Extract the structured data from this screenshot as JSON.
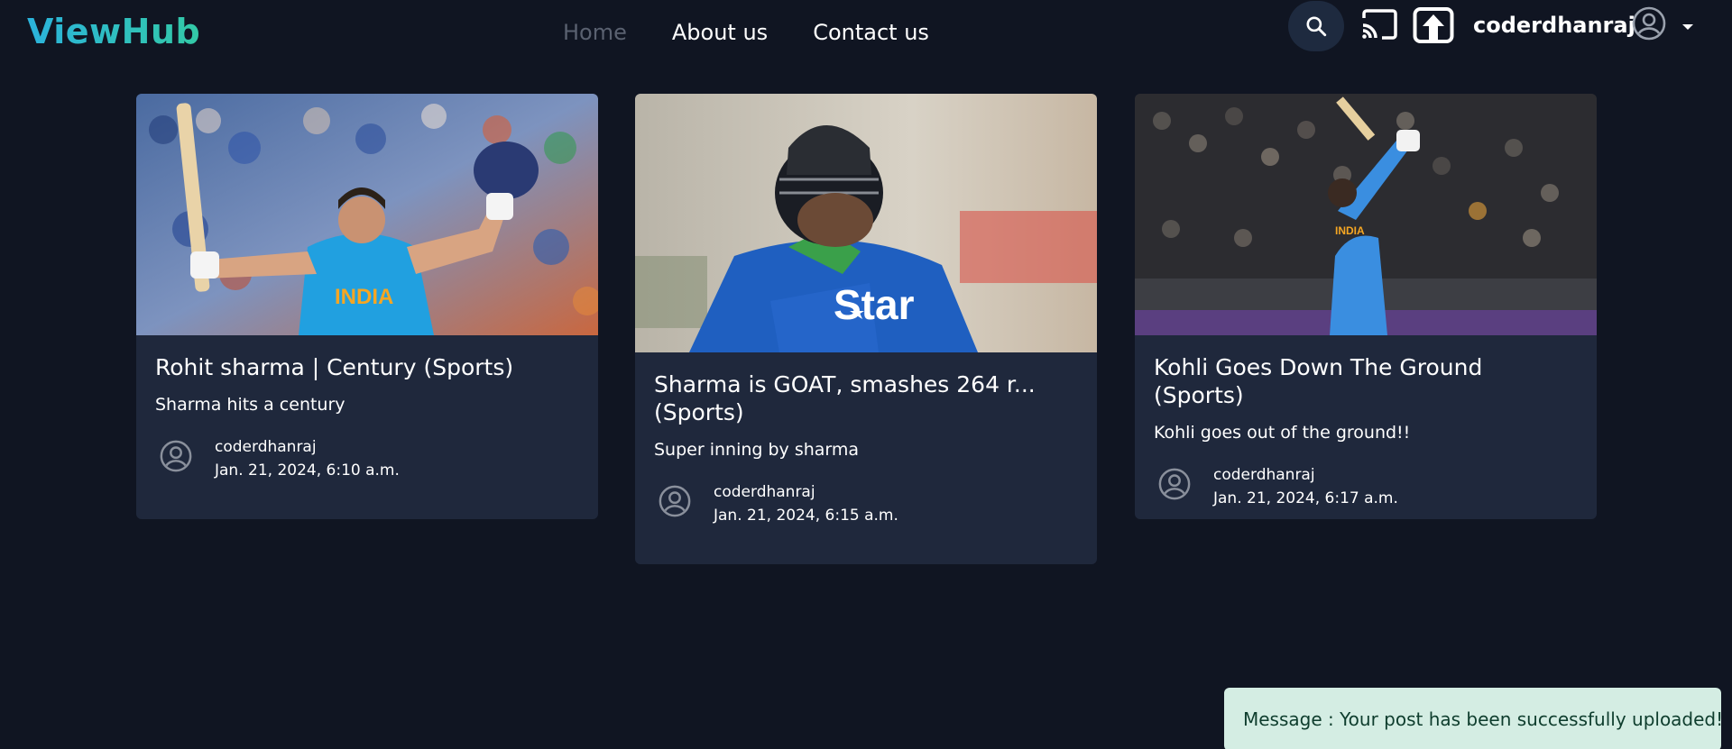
{
  "brand": {
    "name": "ViewHub"
  },
  "nav": {
    "links": [
      {
        "label": "Home"
      },
      {
        "label": "About us"
      },
      {
        "label": "Contact us"
      }
    ],
    "username": "coderdhanraj",
    "icons": [
      "search-icon",
      "cast-icon",
      "upload-icon",
      "user-avatar-icon",
      "caret-down-icon"
    ]
  },
  "posts": [
    {
      "title": "Rohit sharma | Century (Sports)",
      "description": "Sharma hits a century",
      "author": "coderdhanraj",
      "date": "Jan. 21, 2024, 6:10 a.m."
    },
    {
      "title": "Sharma is GOAT, smashes 264 r... (Sports)",
      "description": "Super inning by sharma",
      "author": "coderdhanraj",
      "date": "Jan. 21, 2024, 6:15 a.m."
    },
    {
      "title": "Kohli Goes Down The Ground (Sports)",
      "description": "Kohli goes out of the ground!!",
      "author": "coderdhanraj",
      "date": "Jan. 21, 2024, 6:17 a.m."
    }
  ],
  "toast": {
    "message": "Message : Your post has been successfully uploaded!"
  },
  "colors": {
    "background": "#101522",
    "card": "#1f283c",
    "brand_gradient_start": "#2bb3dc",
    "brand_gradient_end": "#33c9a6",
    "toast_bg": "#d4ede3"
  }
}
